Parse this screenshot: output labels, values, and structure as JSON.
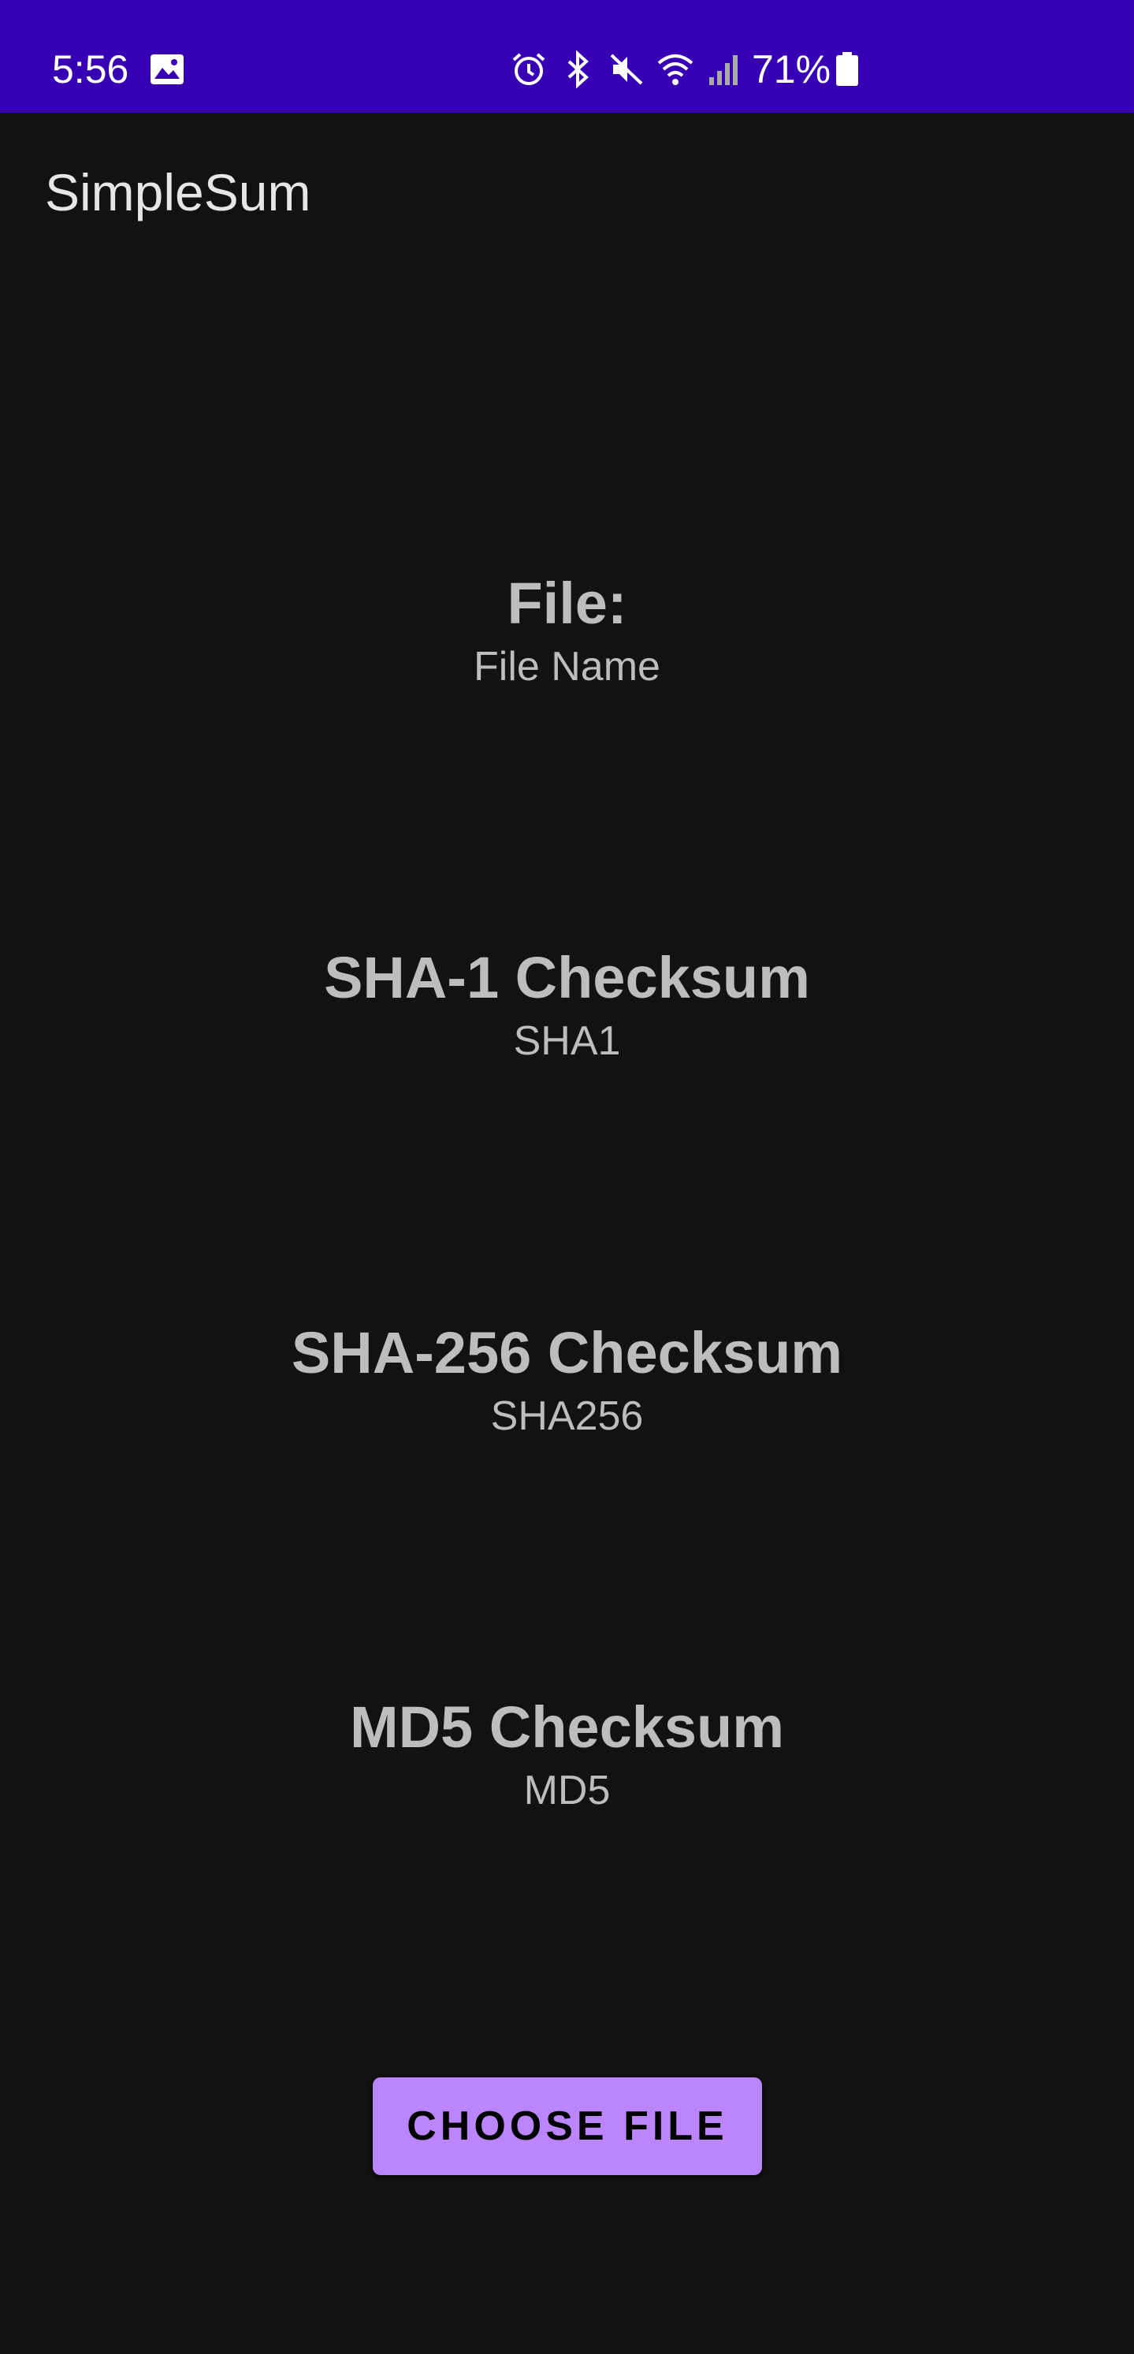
{
  "status_bar": {
    "time": "5:56",
    "battery_percent": "71%",
    "background_color": "#3700b3",
    "icons": [
      "gallery-icon",
      "alarm-icon",
      "bluetooth-icon",
      "mute-icon",
      "wifi-icon",
      "signal-icon",
      "battery-icon"
    ]
  },
  "app_bar": {
    "title": "SimpleSum"
  },
  "sections": {
    "file": {
      "heading": "File:",
      "value": "File Name"
    },
    "sha1": {
      "heading": "SHA-1 Checksum",
      "value": "SHA1"
    },
    "sha256": {
      "heading": "SHA-256 Checksum",
      "value": "SHA256"
    },
    "md5": {
      "heading": "MD5 Checksum",
      "value": "MD5"
    }
  },
  "actions": {
    "choose_file_label": "CHOOSE FILE",
    "accent_color": "#bb86fc"
  }
}
